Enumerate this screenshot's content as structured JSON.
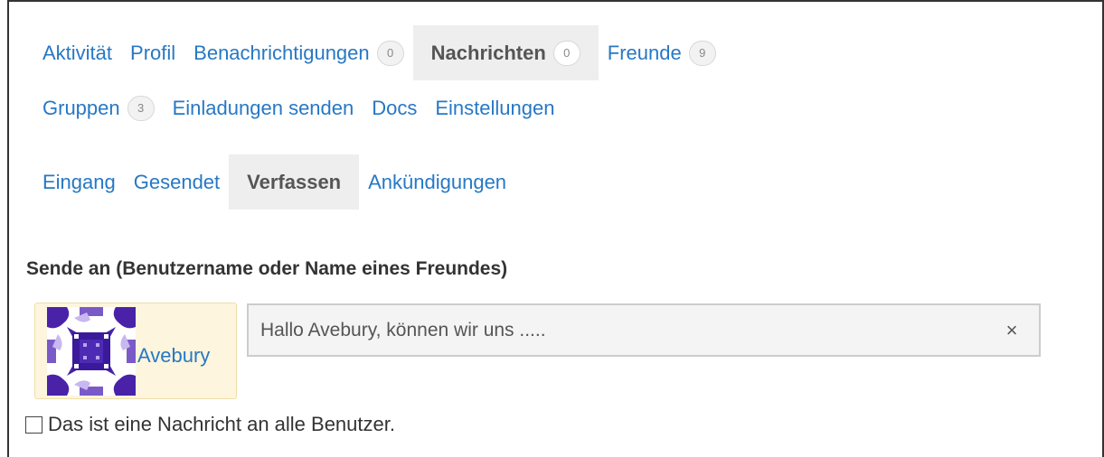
{
  "primary_nav": {
    "items": [
      {
        "label": "Aktivität"
      },
      {
        "label": "Profil"
      },
      {
        "label": "Benachrichtigungen",
        "count": "0"
      },
      {
        "label": "Nachrichten",
        "count": "0",
        "current": true
      },
      {
        "label": "Freunde",
        "count": "9"
      },
      {
        "label": "Gruppen",
        "count": "3"
      },
      {
        "label": "Einladungen senden"
      },
      {
        "label": "Docs"
      },
      {
        "label": "Einstellungen"
      }
    ]
  },
  "messages_nav": {
    "items": [
      {
        "label": "Eingang"
      },
      {
        "label": "Gesendet"
      },
      {
        "label": "Verfassen",
        "current": true
      },
      {
        "label": "Ankündigungen"
      }
    ]
  },
  "compose": {
    "to_label": "Sende an (Benutzername oder Name eines Freundes)",
    "recipient": {
      "name": "Avebury",
      "avatar_icon": "identicon-avatar",
      "avatar_color": "#4a22a8"
    },
    "input_value": "Hallo Avebury, können wir uns .....",
    "clear_symbol": "×",
    "notice_label": "Das ist eine Nachricht an alle Benutzer.",
    "notice_checked": false
  },
  "colors": {
    "link": "#2778c4",
    "current_tab_bg": "#eeeeee",
    "chip_bg": "#fdf5dd"
  }
}
